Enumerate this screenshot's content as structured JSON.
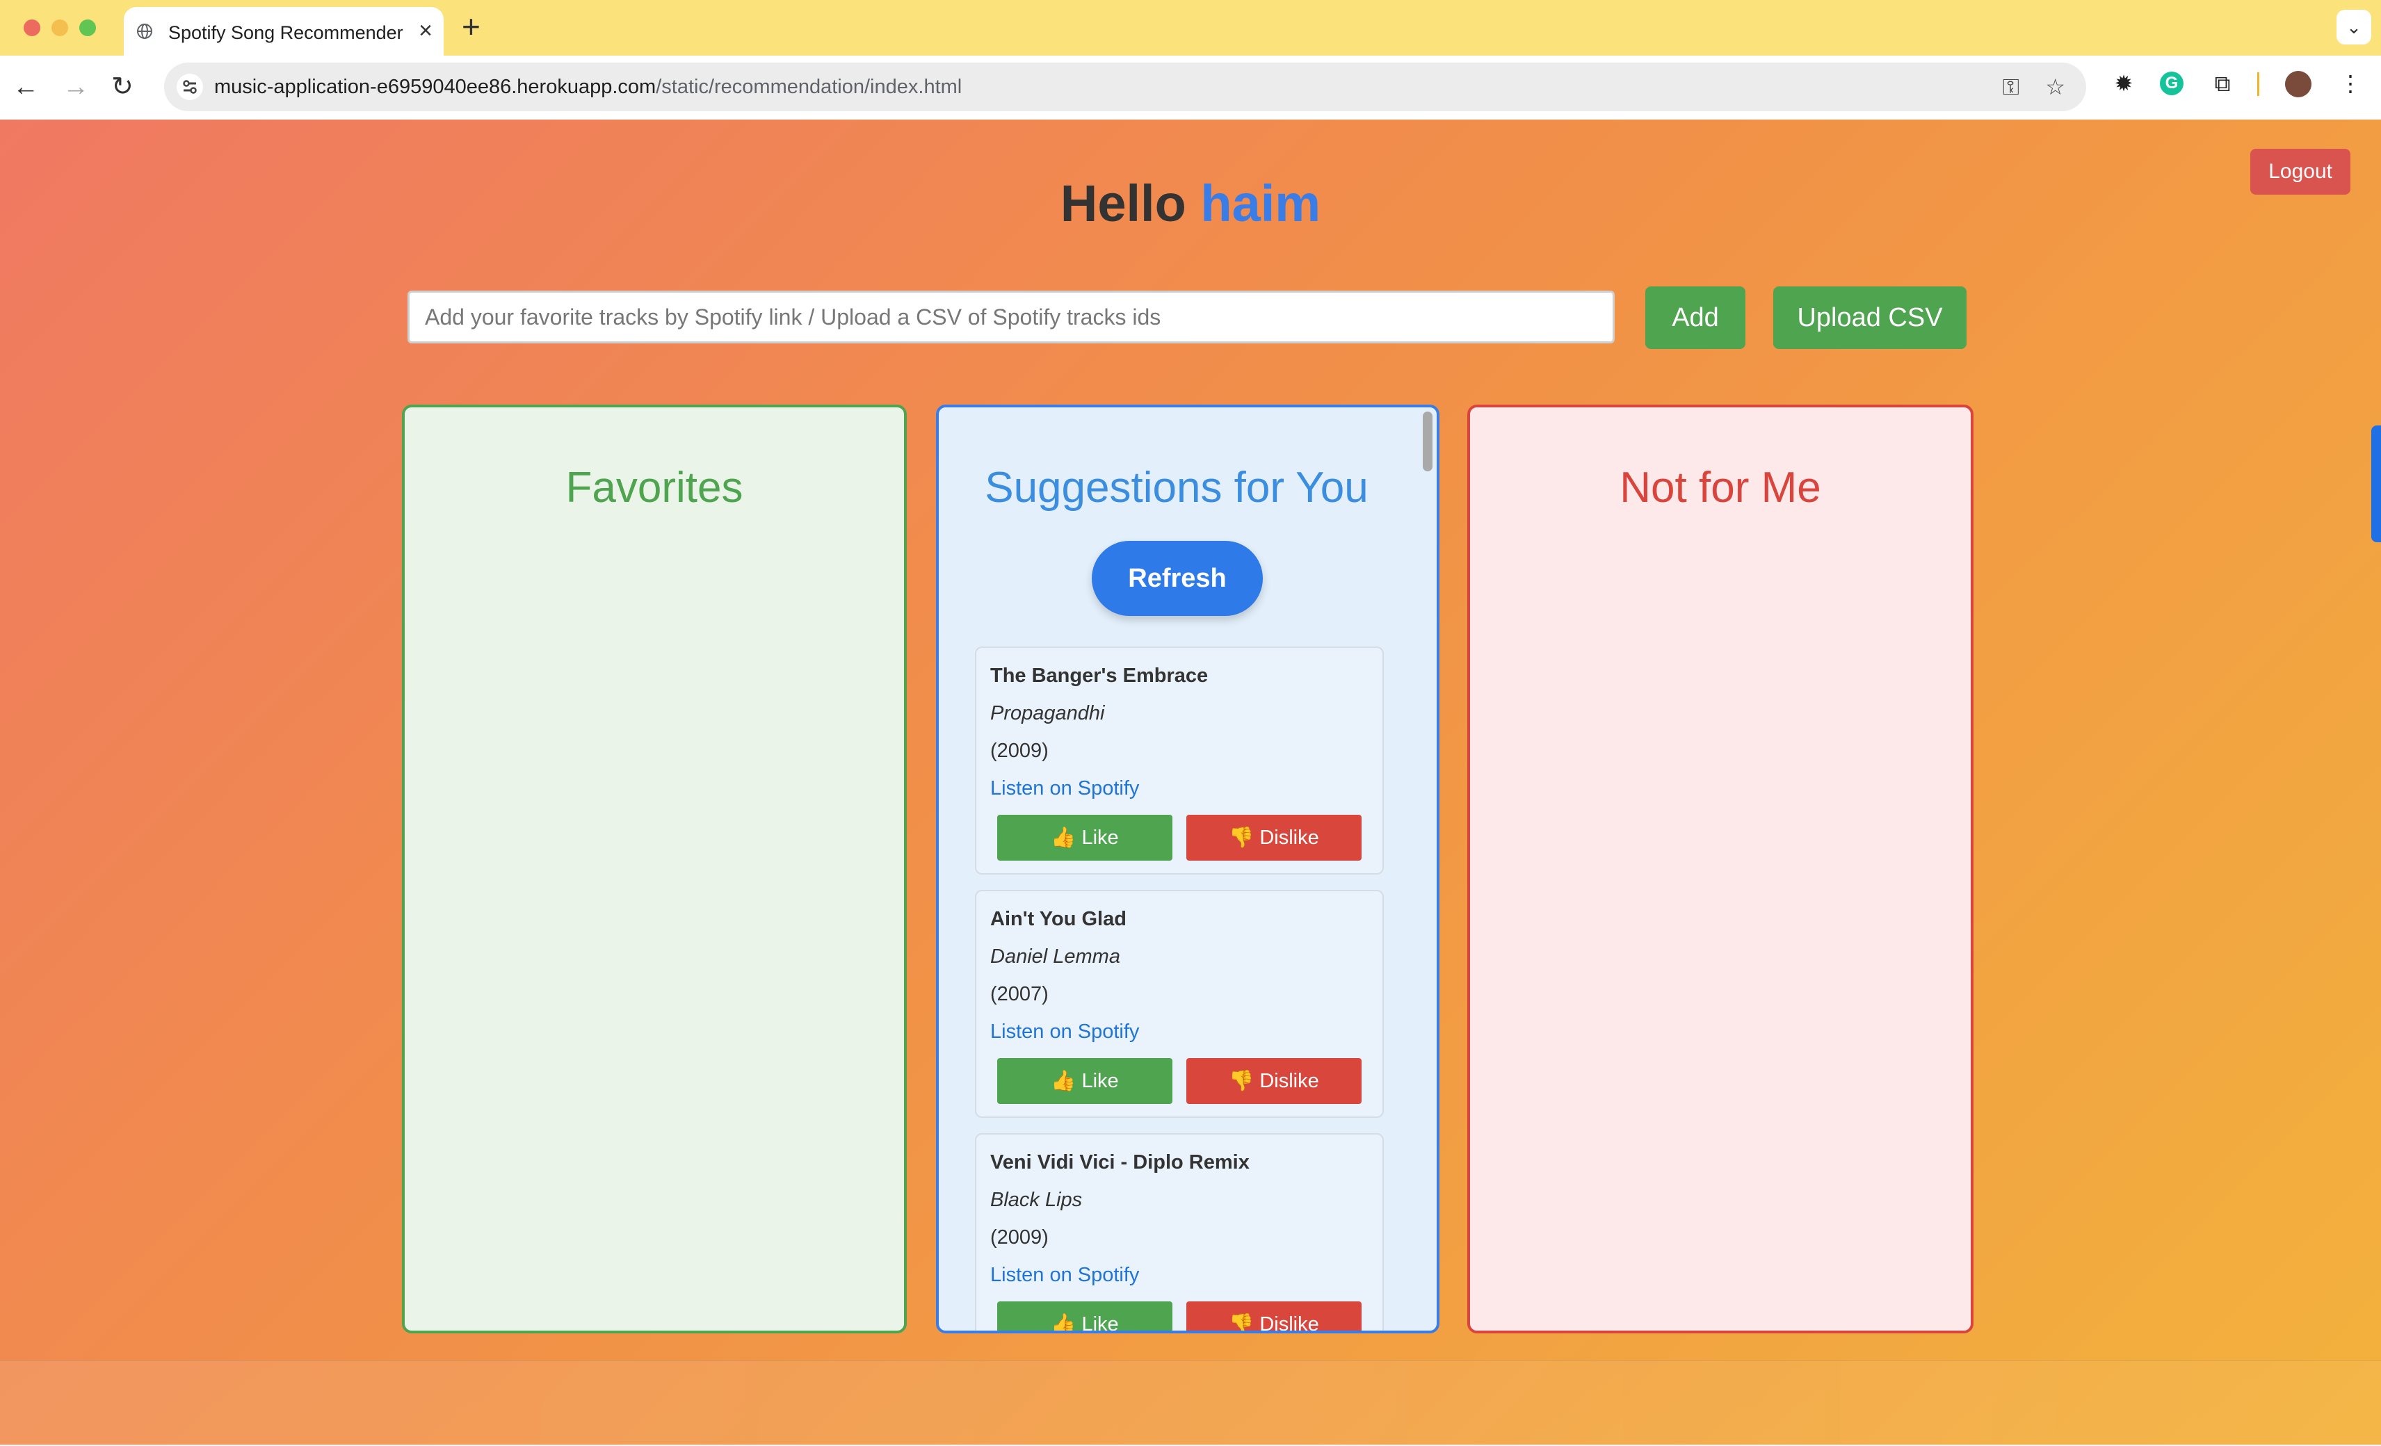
{
  "browser": {
    "tab_title": "Spotify Song Recommender",
    "url_host": "music-application-e6959040ee86.herokuapp.com",
    "url_path": "/static/recommendation/index.html"
  },
  "header": {
    "logout_label": "Logout",
    "greeting_prefix": "Hello",
    "username": "haim"
  },
  "add_form": {
    "placeholder": "Add your favorite tracks by Spotify link / Upload a CSV of Spotify tracks ids",
    "add_label": "Add",
    "upload_label": "Upload CSV"
  },
  "favorites": {
    "title": "Favorites"
  },
  "suggestions": {
    "title": "Suggestions for You",
    "refresh_label": "Refresh",
    "like_label": "Like",
    "dislike_label": "Dislike",
    "tracks": [
      {
        "title": "The Banger's Embrace",
        "artist": "Propagandhi",
        "year": "(2009)",
        "link": "Listen on Spotify"
      },
      {
        "title": "Ain't You Glad",
        "artist": "Daniel Lemma",
        "year": "(2007)",
        "link": "Listen on Spotify"
      },
      {
        "title": "Veni Vidi Vici - Diplo Remix",
        "artist": "Black Lips",
        "year": "(2009)",
        "link": "Listen on Spotify"
      }
    ]
  },
  "not_for_me": {
    "title": "Not for Me"
  },
  "colors": {
    "green": "#4fa450",
    "blue": "#3b7de6",
    "red": "#d9443c",
    "tab_strip": "#fbe27b"
  }
}
